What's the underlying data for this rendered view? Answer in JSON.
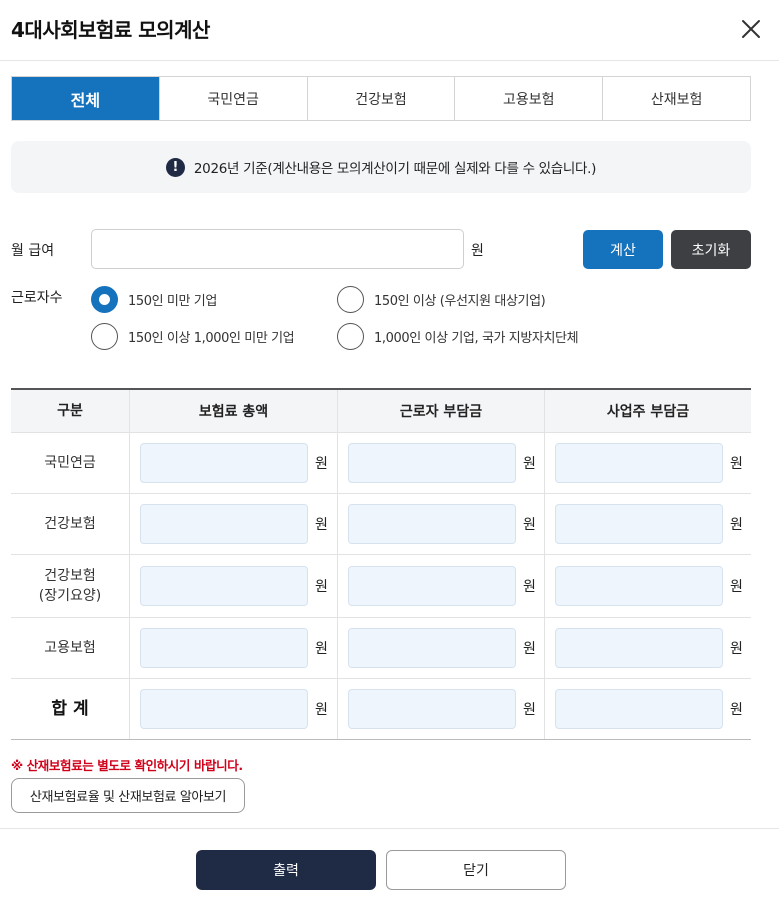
{
  "title": "4대사회보험료 모의계산",
  "close_icon": "close-icon",
  "tabs": [
    {
      "label": "전체",
      "active": true
    },
    {
      "label": "국민연금",
      "active": false
    },
    {
      "label": "건강보험",
      "active": false
    },
    {
      "label": "고용보험",
      "active": false
    },
    {
      "label": "산재보험",
      "active": false
    }
  ],
  "notice": {
    "icon": "exclamation-icon",
    "text": "2026년 기준(계산내용은 모의계산이기 때문에 실제와 다를 수 있습니다.)"
  },
  "salary": {
    "label": "월 급여",
    "value": "",
    "placeholder": "",
    "unit": "원"
  },
  "buttons": {
    "calculate": "계산",
    "reset": "초기화"
  },
  "workers": {
    "label": "근로자수",
    "options": [
      {
        "label": "150인 미만 기업",
        "checked": true
      },
      {
        "label": "150인 이상 (우선지원 대상기업)",
        "checked": false
      },
      {
        "label": "150인 이상 1,000인 미만 기업",
        "checked": false
      },
      {
        "label": "1,000인 이상 기업, 국가 지방자치단체",
        "checked": false
      }
    ]
  },
  "table": {
    "headers": [
      "구분",
      "보험료 총액",
      "근로자 부담금",
      "사업주 부담금"
    ],
    "unit": "원",
    "rows": [
      {
        "label": "국민연금",
        "total": "",
        "employee": "",
        "employer": ""
      },
      {
        "label": "건강보험",
        "total": "",
        "employee": "",
        "employer": ""
      },
      {
        "label": "건강보험",
        "label2": "(장기요양)",
        "total": "",
        "employee": "",
        "employer": ""
      },
      {
        "label": "고용보험",
        "total": "",
        "employee": "",
        "employer": ""
      }
    ],
    "total_row": {
      "label": "합 계",
      "total": "",
      "employee": "",
      "employer": ""
    }
  },
  "warning": "※ 산재보험료는 별도로 확인하시기 바랍니다.",
  "info_button": "산재보험료율 및 산재보험료 알아보기",
  "footer": {
    "print": "출력",
    "close": "닫기"
  },
  "colors": {
    "primary": "#1572bd",
    "dark": "#3d3f42",
    "navy": "#1f2a44",
    "warning": "#d0021b",
    "field_bg": "#eef5fc"
  }
}
